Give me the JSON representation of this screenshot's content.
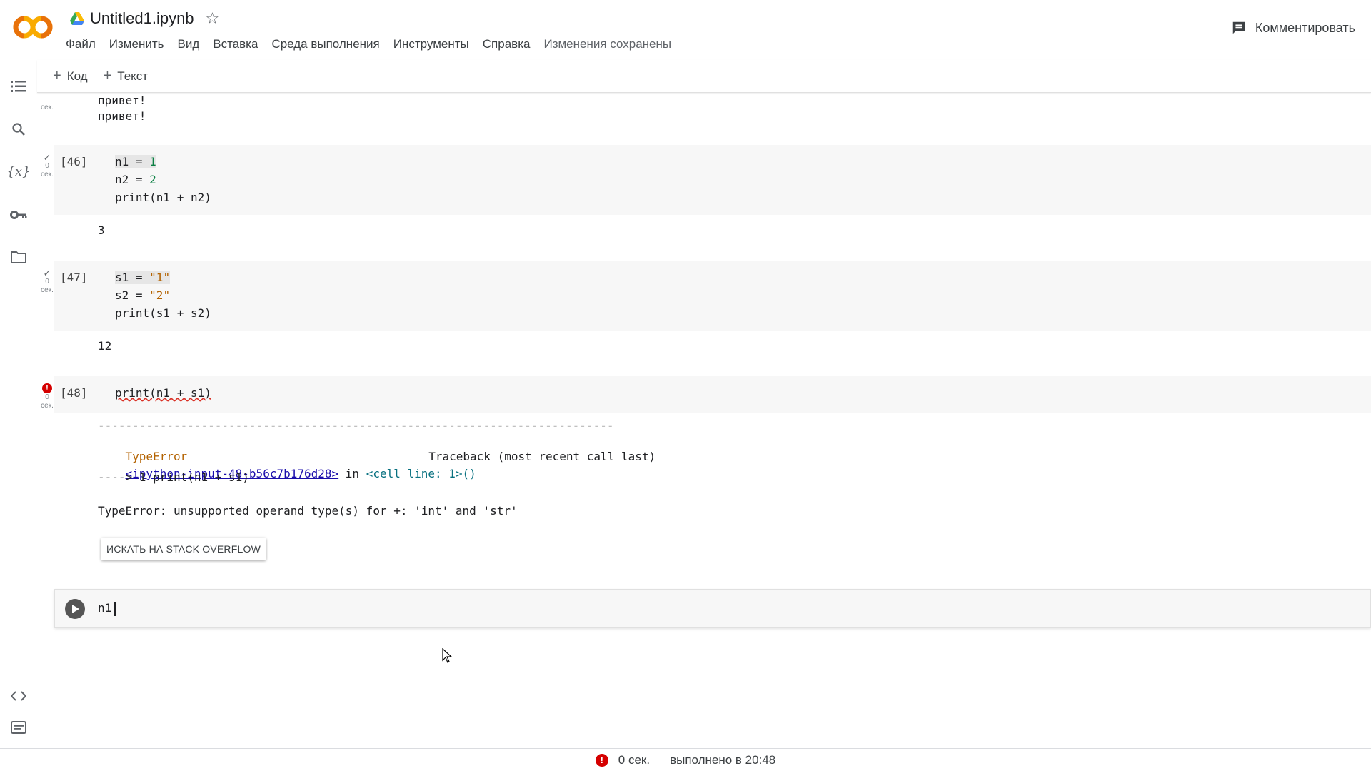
{
  "header": {
    "doc_title": "Untitled1.ipynb",
    "menu": [
      "Файл",
      "Изменить",
      "Вид",
      "Вставка",
      "Среда выполнения",
      "Инструменты",
      "Справка"
    ],
    "saved_status": "Изменения сохранены",
    "comment_label": "Комментировать",
    "logo_text": "CO"
  },
  "toolbar": {
    "add_code": "Код",
    "add_text": "Текст"
  },
  "cells": {
    "c0": {
      "output": [
        "привет!",
        "привет!"
      ],
      "time_unit": "сек."
    },
    "c46": {
      "exec_count": "[46]",
      "time": "0",
      "time_unit": "сек.",
      "code": [
        "n1 = 1",
        "n2 = 2",
        "print(n1 + n2)"
      ],
      "output": "3"
    },
    "c47": {
      "exec_count": "[47]",
      "time": "0",
      "time_unit": "сек.",
      "code": [
        "s1 = \"1\"",
        "s2 = \"2\"",
        "print(s1 + s2)"
      ],
      "output": "12"
    },
    "c48": {
      "exec_count": "[48]",
      "time": "0",
      "time_unit": "сек.",
      "code": "print(n1 + s1)",
      "traceback": {
        "separator": "---------------------------------------------------------------------------",
        "error_name": "TypeError",
        "traceback_label": "Traceback (most recent call last)",
        "input_link": "<ipython-input-48-b56c7b176d28>",
        "in_word": " in ",
        "cell_ref": "<cell line: 1>()",
        "arrow_line": "----> 1 print(n1 + s1)",
        "message": "TypeError: unsupported operand type(s) for +: 'int' and 'str'"
      },
      "stackoverflow_button": "ИСКАТЬ НА STACK OVERFLOW"
    },
    "active": {
      "input": "n1"
    }
  },
  "statusbar": {
    "duration": "0 сек.",
    "completed": "выполнено в 20:48"
  },
  "colors": {
    "accent_orange": "#f9ab00",
    "error_red": "#d50000",
    "number_green": "#0b8043",
    "string_orange": "#b36200"
  },
  "icons": {
    "left_rail": [
      "toc-icon",
      "search-icon",
      "variables-icon",
      "key-icon",
      "folder-icon",
      "code-snippets-icon",
      "terminal-icon"
    ]
  }
}
